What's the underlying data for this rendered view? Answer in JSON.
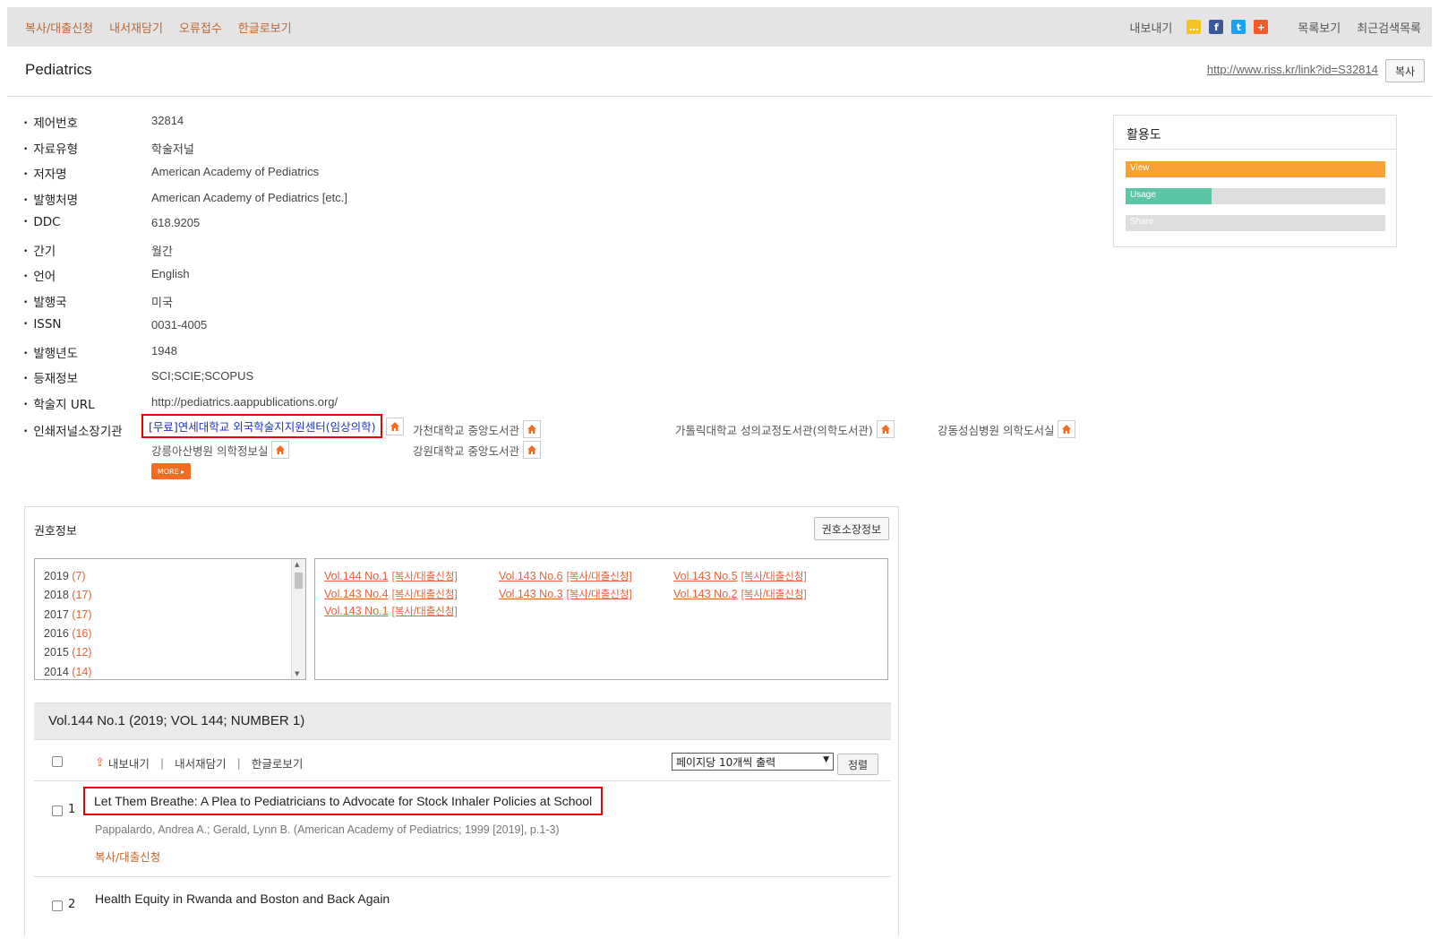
{
  "topbar": {
    "left_links": [
      "복사/대출신청",
      "내서재담기",
      "오류접수",
      "한글로보기"
    ],
    "export": "내보내기",
    "right_links": [
      "목록보기",
      "최근검색목록"
    ]
  },
  "header": {
    "title": "Pediatrics",
    "permalink": "http://www.riss.kr/link?id=S32814",
    "copy_label": "복사"
  },
  "meta": [
    {
      "key": "제어번호",
      "value": "32814"
    },
    {
      "key": "자료유형",
      "value": "학술저널"
    },
    {
      "key": "저자명",
      "value": "American Academy of Pediatrics"
    },
    {
      "key": "발행처명",
      "value": "American Academy of Pediatrics [etc.]"
    },
    {
      "key": "DDC",
      "value": "618.9205"
    },
    {
      "key": "간기",
      "value": "월간"
    },
    {
      "key": "언어",
      "value": "English"
    },
    {
      "key": "발행국",
      "value": "미국"
    },
    {
      "key": "ISSN",
      "value": "0031-4005"
    },
    {
      "key": "발행년도",
      "value": "1948"
    },
    {
      "key": "등재정보",
      "value": "SCI;SCIE;SCOPUS"
    },
    {
      "key": "학술지 URL",
      "value": "http://pediatrics.aappublications.org/"
    }
  ],
  "holdings": {
    "label": "인쇄저널소장기관",
    "highlighted": "[무료]연세대학교 외국학술지지원센터(임상의학)",
    "libraries": [
      "가천대학교 중앙도서관",
      "가톨릭대학교 성의교정도서관(의학도서관)",
      "강동성심병원 의학도서실",
      "강릉아산병원 의학정보실",
      "강원대학교 중앙도서관"
    ],
    "more": "MORE ▸"
  },
  "usage": {
    "title": "활용도",
    "bars": [
      {
        "label": "View",
        "value": 1.0,
        "color": "#f7a034"
      },
      {
        "label": "Usage",
        "value": 0.33,
        "color": "#5cc5a6"
      },
      {
        "label": "Share",
        "value": 0.0,
        "color": "#cccccc"
      }
    ]
  },
  "volumes": {
    "title": "권호정보",
    "holding_btn": "권호소장정보",
    "years": [
      {
        "year": "2019",
        "count": "(7)"
      },
      {
        "year": "2018",
        "count": "(17)"
      },
      {
        "year": "2017",
        "count": "(17)"
      },
      {
        "year": "2016",
        "count": "(16)"
      },
      {
        "year": "2015",
        "count": "(12)"
      },
      {
        "year": "2014",
        "count": "(14)"
      }
    ],
    "issues": [
      {
        "label": "Vol.144 No.1",
        "req": "[복사/대출신청]"
      },
      {
        "label": "Vol.143 No.6",
        "req": "[복사/대출신청]"
      },
      {
        "label": "Vol.143 No.5",
        "req": "[복사/대출신청]"
      },
      {
        "label": "Vol.143 No.4",
        "req": "[복사/대출신청]"
      },
      {
        "label": "Vol.143 No.3",
        "req": "[복사/대출신청]"
      },
      {
        "label": "Vol.143 No.2",
        "req": "[복사/대출신청]"
      },
      {
        "label": "Vol.143 No.1",
        "req": "[복사/대출신청]"
      }
    ],
    "current": "Vol.144 No.1 (2019; VOL 144; NUMBER 1)"
  },
  "toolrow": {
    "export": "내보내기",
    "save": "내서재담기",
    "korean": "한글로보기",
    "per_page": "페이지당 10개씩 출력",
    "sort": "정렬"
  },
  "articles": [
    {
      "num": "1",
      "title": "Let Them Breathe: A Plea to Pediatricians to Advocate for Stock Inhaler Policies at School",
      "authors": "Pappalardo, Andrea A.; Gerald, Lynn B. (American Academy of Pediatrics; 1999 [2019], p.1-3)",
      "req": "복사/대출신청"
    },
    {
      "num": "2",
      "title": "Health Equity in Rwanda and Boston and Back Again"
    }
  ]
}
